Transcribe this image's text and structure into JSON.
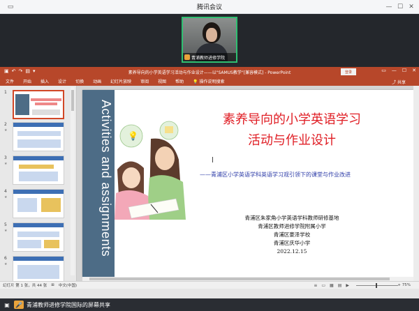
{
  "meeting": {
    "window_title": "腾讯会议",
    "participant_name": "青浦教师进修学院",
    "bottom_label": "青浦教师进修学院国际的屏幕共享"
  },
  "powerpoint": {
    "doc_title": "素养导向的小学英语学习活动与作业设计——以\"SAMUS教学\"[兼容模式] - PowerPoint",
    "login_label": "登录",
    "tabs": [
      "文件",
      "开始",
      "插入",
      "设计",
      "切换",
      "动画",
      "幻灯片放映",
      "审阅",
      "视图",
      "帮助",
      "操作说明搜索"
    ],
    "share_label": "共享",
    "thumbnails": [
      {
        "num": "1",
        "star": "★"
      },
      {
        "num": "2",
        "star": "★"
      },
      {
        "num": "3",
        "star": "★"
      },
      {
        "num": "4",
        "star": "★"
      },
      {
        "num": "5",
        "star": "★"
      },
      {
        "num": "6",
        "star": "★"
      }
    ],
    "status": {
      "slide_info": "幻灯片 第 1 张，共 44 张",
      "language": "中文(中国)",
      "zoom": "+ 75%"
    }
  },
  "slide": {
    "vertical_text": "Activities and assignments",
    "title_line1": "素养导向的小学英语学习",
    "title_line2": "活动与作业设计",
    "subtitle": "——青浦区小学英语学科英语学习观引领下的课堂与作业改进",
    "orgs": [
      "青浦区朱家角小学英语学科教师研修基地",
      "青浦区教师进修学院附属小学",
      "青浦区豪泽学校",
      "青浦区庆华小学",
      "2022.12.15"
    ]
  },
  "colors": {
    "accent_red": "#b7472a",
    "title_red": "#e01e25",
    "subtitle_blue": "#2b3aa7",
    "band_blue": "#4d6c86",
    "active_green": "#2fbf71"
  }
}
